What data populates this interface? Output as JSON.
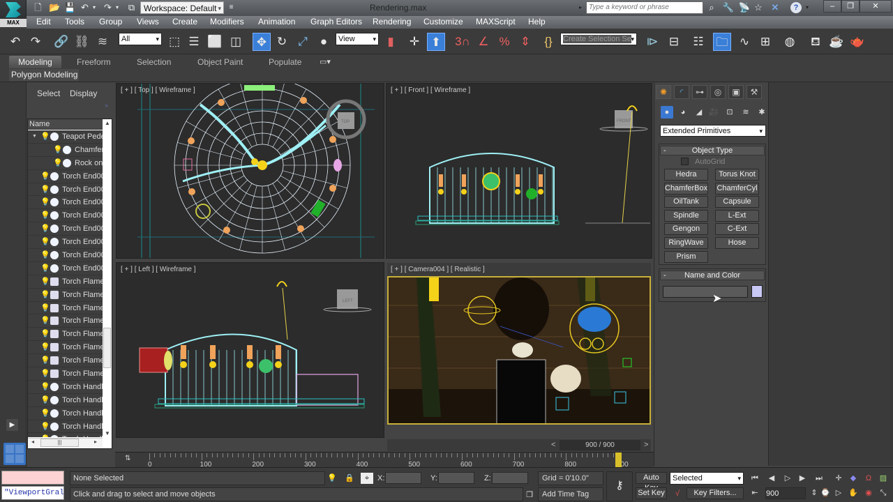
{
  "app": {
    "logo_label": "MAX",
    "file_title": "Rendering.max",
    "workspace": "Workspace: Default"
  },
  "search": {
    "placeholder": "Type a keyword or phrase"
  },
  "menu": [
    "Edit",
    "Tools",
    "Group",
    "Views",
    "Create",
    "Modifiers",
    "Animation",
    "Graph Editors",
    "Rendering",
    "Customize",
    "MAXScript",
    "Help"
  ],
  "toolbar": {
    "selection_filter": "All",
    "ref_coord": "View",
    "named_selection_placeholder": "Create Selection Se"
  },
  "ribbon": {
    "tabs": [
      "Modeling",
      "Freeform",
      "Selection",
      "Object Paint",
      "Populate"
    ],
    "active_tab": "Modeling",
    "panel_label": "Polygon Modeling"
  },
  "scene_explorer": {
    "tabs": [
      "Select",
      "Display"
    ],
    "column_header": "Name",
    "rows": [
      {
        "name": "Teapot Pede",
        "level": 0,
        "type": "geo",
        "expanded": true
      },
      {
        "name": "Chamfer",
        "level": 1,
        "type": "geo"
      },
      {
        "name": "Rock on",
        "level": 1,
        "type": "geo"
      },
      {
        "name": "Torch End00",
        "level": 0,
        "type": "geo"
      },
      {
        "name": "Torch End00",
        "level": 0,
        "type": "geo"
      },
      {
        "name": "Torch End00",
        "level": 0,
        "type": "geo"
      },
      {
        "name": "Torch End00",
        "level": 0,
        "type": "geo"
      },
      {
        "name": "Torch End00",
        "level": 0,
        "type": "geo"
      },
      {
        "name": "Torch End00",
        "level": 0,
        "type": "geo"
      },
      {
        "name": "Torch End00",
        "level": 0,
        "type": "geo"
      },
      {
        "name": "Torch End00",
        "level": 0,
        "type": "geo"
      },
      {
        "name": "Torch Flame",
        "level": 0,
        "type": "fx"
      },
      {
        "name": "Torch Flame",
        "level": 0,
        "type": "fx"
      },
      {
        "name": "Torch Flame",
        "level": 0,
        "type": "fx"
      },
      {
        "name": "Torch Flame",
        "level": 0,
        "type": "fx"
      },
      {
        "name": "Torch Flame",
        "level": 0,
        "type": "fx"
      },
      {
        "name": "Torch Flame",
        "level": 0,
        "type": "fx"
      },
      {
        "name": "Torch Flame",
        "level": 0,
        "type": "fx"
      },
      {
        "name": "Torch Flame",
        "level": 0,
        "type": "fx"
      },
      {
        "name": "Torch Handl",
        "level": 0,
        "type": "geo"
      },
      {
        "name": "Torch Handl",
        "level": 0,
        "type": "geo"
      },
      {
        "name": "Torch Handl",
        "level": 0,
        "type": "geo"
      },
      {
        "name": "Torch Handl",
        "level": 0,
        "type": "geo"
      },
      {
        "name": "Torch Handl",
        "level": 0,
        "type": "geo"
      }
    ]
  },
  "viewports": {
    "top": "[ + ] [ Top ] [ Wireframe ]",
    "front": "[ + ] [ Front ] [ Wireframe ]",
    "left": "[ + ] [ Left ] [ Wireframe ]",
    "camera": "[ + ] [ Camera004 ] [ Realistic ]",
    "viewcube_top": "TOP",
    "viewcube_front": "FRONT",
    "viewcube_left": "LEFT"
  },
  "command_panel": {
    "category": "Extended Primitives",
    "object_type_title": "Object Type",
    "autogrid_label": "AutoGrid",
    "autogrid_checked": false,
    "buttons": [
      "Hedra",
      "Torus Knot",
      "ChamferBox",
      "ChamferCyl",
      "OilTank",
      "Capsule",
      "Spindle",
      "L-Ext",
      "Gengon",
      "C-Ext",
      "RingWave",
      "Hose",
      "Prism"
    ],
    "name_color_title": "Name and Color",
    "name_value": "",
    "color": "#c8c8f5"
  },
  "timeline": {
    "frame_display": "900 / 900",
    "current_frame": 900,
    "start": 0,
    "end": 900,
    "labels": [
      "0",
      "100",
      "200",
      "300",
      "400",
      "500",
      "600",
      "700",
      "800",
      "900"
    ]
  },
  "status": {
    "maxscript_listener": "\"ViewportGral",
    "selection": "None Selected",
    "prompt": "Click and drag to select and move objects",
    "x_label": "X:",
    "y_label": "Y:",
    "z_label": "Z:",
    "x": "",
    "y": "",
    "z": "",
    "grid": "Grid = 0'10.0\"",
    "add_time_tag": "Add Time Tag",
    "auto_key": "Auto Key",
    "set_key": "Set Key",
    "key_mode": "Selected",
    "key_filters": "Key Filters...",
    "frame_field": "900"
  }
}
